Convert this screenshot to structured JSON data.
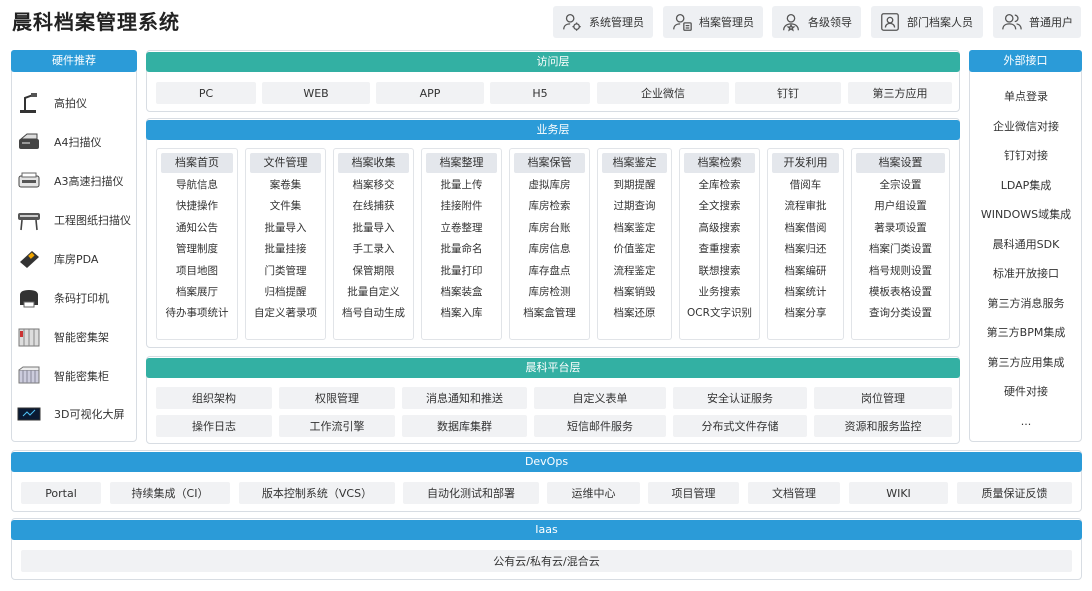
{
  "title": "晨科档案管理系统",
  "roles": [
    "系统管理员",
    "档案管理员",
    "各级领导",
    "部门档案人员",
    "普通用户"
  ],
  "hardware": {
    "header": "硬件推荐",
    "items": [
      "高拍仪",
      "A4扫描仪",
      "A3高速扫描仪",
      "工程图纸扫描仪",
      "库房PDA",
      "条码打印机",
      "智能密集架",
      "智能密集柜",
      "3D可视化大屏"
    ]
  },
  "access": {
    "header": "访问层",
    "items": [
      "PC",
      "WEB",
      "APP",
      "H5",
      "企业微信",
      "钉钉",
      "第三方应用"
    ]
  },
  "business": {
    "header": "业务层",
    "columns": [
      {
        "title": "档案首页",
        "items": [
          "导航信息",
          "快捷操作",
          "通知公告",
          "管理制度",
          "项目地图",
          "档案展厅",
          "待办事项统计"
        ]
      },
      {
        "title": "文件管理",
        "items": [
          "案卷集",
          "文件集",
          "批量导入",
          "批量挂接",
          "门类管理",
          "归档提醒",
          "自定义著录项"
        ]
      },
      {
        "title": "档案收集",
        "items": [
          "档案移交",
          "在线捕获",
          "批量导入",
          "手工录入",
          "保管期限",
          "批量自定义",
          "档号自动生成"
        ]
      },
      {
        "title": "档案整理",
        "items": [
          "批量上传",
          "挂接附件",
          "立卷整理",
          "批量命名",
          "批量打印",
          "档案装盒",
          "档案入库"
        ]
      },
      {
        "title": "档案保管",
        "items": [
          "虚拟库房",
          "库房检索",
          "库房台账",
          "库房信息",
          "库存盘点",
          "库房检测",
          "档案盒管理"
        ]
      },
      {
        "title": "档案鉴定",
        "items": [
          "到期提醒",
          "过期查询",
          "档案鉴定",
          "价值鉴定",
          "流程鉴定",
          "档案销毁",
          "档案还原"
        ]
      },
      {
        "title": "档案检索",
        "items": [
          "全库检索",
          "全文搜索",
          "高级搜索",
          "查重搜索",
          "联想搜索",
          "业务搜索",
          "OCR文字识别"
        ]
      },
      {
        "title": "开发利用",
        "items": [
          "借阅车",
          "流程审批",
          "档案借阅",
          "档案归还",
          "档案编研",
          "档案统计",
          "档案分享"
        ]
      },
      {
        "title": "档案设置",
        "items": [
          "全宗设置",
          "用户组设置",
          "著录项设置",
          "档案门类设置",
          "档号规则设置",
          "模板表格设置",
          "查询分类设置"
        ]
      }
    ]
  },
  "platform": {
    "header": "晨科平台层",
    "row1": [
      "组织架构",
      "权限管理",
      "消息通知和推送",
      "自定义表单",
      "安全认证服务",
      "岗位管理"
    ],
    "row2": [
      "操作日志",
      "工作流引擎",
      "数据库集群",
      "短信邮件服务",
      "分布式文件存储",
      "资源和服务监控"
    ]
  },
  "external": {
    "header": "外部接口",
    "items": [
      "单点登录",
      "企业微信对接",
      "钉钉对接",
      "LDAP集成",
      "WINDOWS域集成",
      "晨科通用SDK",
      "标准开放接口",
      "第三方消息服务",
      "第三方BPM集成",
      "第三方应用集成",
      "硬件对接",
      "..."
    ]
  },
  "devops": {
    "header": "DevOps",
    "items": [
      "Portal",
      "持续集成（CI）",
      "版本控制系统（VCS）",
      "自动化测试和部署",
      "运维中心",
      "项目管理",
      "文档管理",
      "WIKI",
      "质量保证反馈"
    ]
  },
  "iaas": {
    "header": "Iaas",
    "item": "公有云/私有云/混合云"
  },
  "colors": {
    "teal": "#33b0a3",
    "blue": "#2b9bd8",
    "cell": "#f1f2f4"
  }
}
